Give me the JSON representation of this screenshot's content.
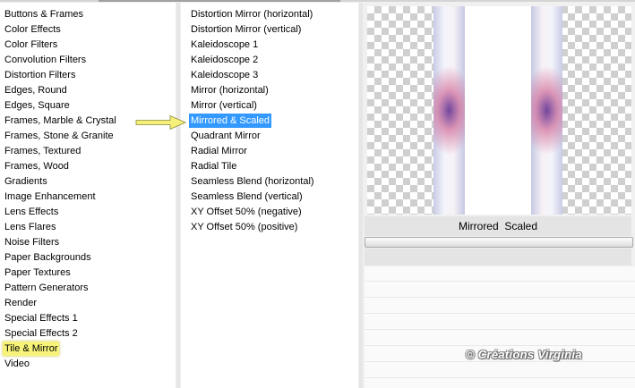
{
  "categories": [
    "Buttons & Frames",
    "Color Effects",
    "Color Filters",
    "Convolution Filters",
    "Distortion Filters",
    "Edges, Round",
    "Edges, Square",
    "Frames, Marble & Crystal",
    "Frames, Stone & Granite",
    "Frames, Textured",
    "Frames, Wood",
    "Gradients",
    "Image Enhancement",
    "Lens Effects",
    "Lens Flares",
    "Noise Filters",
    "Paper Backgrounds",
    "Paper Textures",
    "Pattern Generators",
    "Render",
    "Special Effects 1",
    "Special Effects 2",
    "Tile & Mirror",
    "Video"
  ],
  "selected_category": "Tile & Mirror",
  "filters": [
    "Distortion Mirror (horizontal)",
    "Distortion Mirror (vertical)",
    "Kaleidoscope 1",
    "Kaleidoscope 2",
    "Kaleidoscope 3",
    "Mirror (horizontal)",
    "Mirror (vertical)",
    "Mirrored & Scaled",
    "Quadrant Mirror",
    "Radial Mirror",
    "Radial Tile",
    "Seamless Blend (horizontal)",
    "Seamless Blend (vertical)",
    "XY Offset 50% (negative)",
    "XY Offset 50% (positive)"
  ],
  "selected_filter": "Mirrored & Scaled",
  "preview": {
    "label": "Mirrored  Scaled"
  },
  "watermark": "© Créations Virginia",
  "colors": {
    "selection": "#3399ff",
    "highlight": "#f7f37a",
    "arrow": "#f5f07a"
  }
}
